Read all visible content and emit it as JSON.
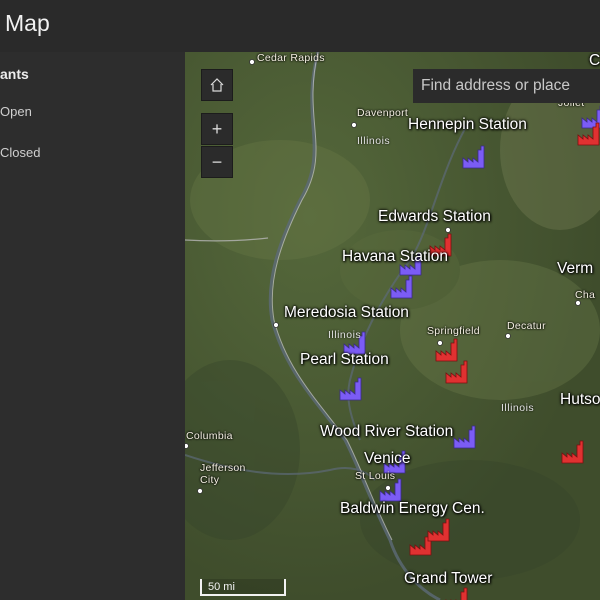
{
  "app": {
    "title": "Map"
  },
  "legend": {
    "title": "ants",
    "items": [
      {
        "label": "Open",
        "color": "#7b5cf5"
      },
      {
        "label": "Closed",
        "color": "#e03131"
      }
    ]
  },
  "controls": {
    "home_icon": "home-icon",
    "zoom_in": "+",
    "zoom_out": "−"
  },
  "search": {
    "placeholder": "Find address or place"
  },
  "scalebar": {
    "label": "50 mi"
  },
  "plant_labels": {
    "hennepin": "Hennepin Station",
    "edwards": "Edwards Station",
    "havana": "Havana Station",
    "meredosia": "Meredosia Station",
    "pearl": "Pearl Station",
    "wood_river": "Wood River Station",
    "venice": "Venice",
    "baldwin": "Baldwin Energy Cen.",
    "grand_tower": "Grand Tower",
    "vermilion": "Verm",
    "hutsonville": "Hutso",
    "corner_c": "C"
  },
  "city_labels": {
    "cedar_rapids": "Cedar Rapids",
    "davenport": "Davenport",
    "joliet": "Joliet",
    "springfield": "Springfield",
    "decatur": "Decatur",
    "champaign": "Cha",
    "st_louis": "St Louis",
    "columbia": "Columbia",
    "jefferson_city": "Jefferson\nCity"
  },
  "state_labels": {
    "illinois_north": "Illinois",
    "illinois_mid": "Illinois",
    "illinois_east": "Illinois"
  },
  "plants": [
    {
      "name": "Hennepin Station",
      "status": "Open"
    },
    {
      "name": "Edwards Station",
      "status": "Closed"
    },
    {
      "name": "Havana Station",
      "status": "Open"
    },
    {
      "name": "Meredosia Station",
      "status": "Open"
    },
    {
      "name": "Pearl Station",
      "status": "Open"
    },
    {
      "name": "Wood River Station",
      "status": "Open"
    },
    {
      "name": "Venice",
      "status": "Open"
    },
    {
      "name": "Baldwin Energy Cen.",
      "status": "Closed"
    },
    {
      "name": "Grand Tower",
      "status": "Closed"
    },
    {
      "name": "Joliet",
      "status": "Open"
    },
    {
      "name": "Hutsonville",
      "status": "Closed"
    }
  ]
}
